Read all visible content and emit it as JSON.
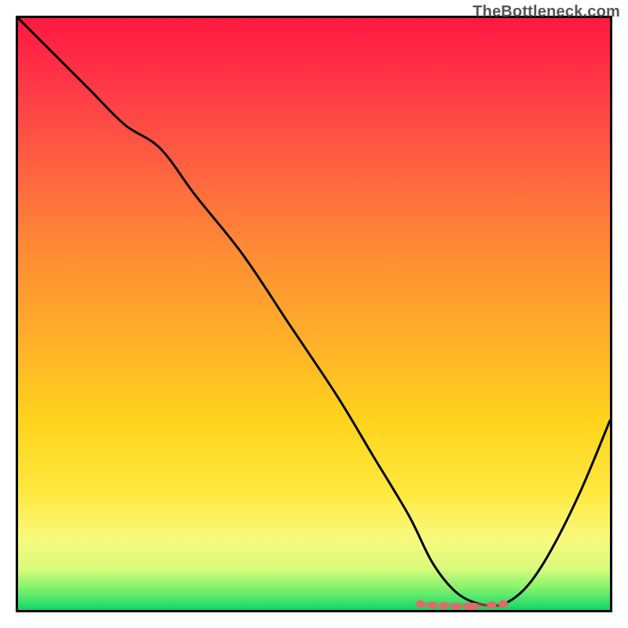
{
  "watermark": {
    "text": "TheBottleneck.com"
  },
  "chart_data": {
    "type": "line",
    "title": "",
    "xlabel": "",
    "ylabel": "",
    "xlim": [
      0,
      100
    ],
    "ylim": [
      0,
      100
    ],
    "grid": false,
    "legend": null,
    "gradient_background": {
      "direction": "vertical",
      "stops": [
        {
          "pos": 0,
          "color": "#ff1840"
        },
        {
          "pos": 28,
          "color": "#ff6a3f"
        },
        {
          "pos": 55,
          "color": "#ffb128"
        },
        {
          "pos": 80,
          "color": "#fee83d"
        },
        {
          "pos": 93,
          "color": "#d9fb7d"
        },
        {
          "pos": 100,
          "color": "#12d168"
        }
      ]
    },
    "series": [
      {
        "name": "bottleneck-curve",
        "x": [
          0,
          5,
          12,
          18,
          24,
          30,
          38,
          46,
          54,
          60,
          66,
          70,
          74,
          78,
          82,
          86,
          90,
          95,
          100
        ],
        "y": [
          100,
          95,
          88,
          82,
          78,
          70,
          60,
          48,
          36,
          26,
          16,
          8,
          3,
          1,
          1,
          4,
          10,
          20,
          32
        ]
      }
    ],
    "markers": {
      "name": "optimal-range",
      "color": "#e06a6a",
      "x": [
        68,
        70,
        72,
        74,
        76,
        77,
        80,
        82
      ],
      "y": [
        1.0,
        0.8,
        0.7,
        0.6,
        0.6,
        0.6,
        0.8,
        1.0
      ]
    }
  }
}
